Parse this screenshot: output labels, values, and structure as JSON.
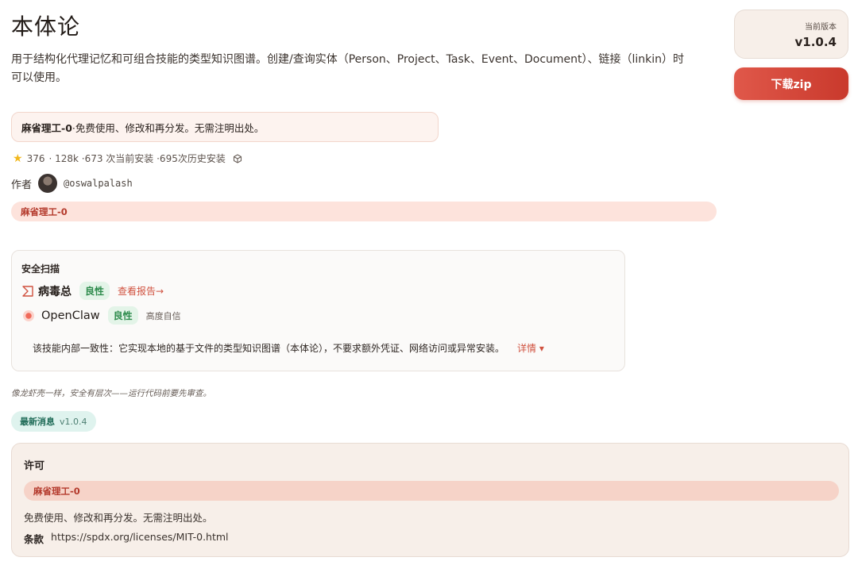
{
  "header": {
    "title": "本体论",
    "description": "用于结构化代理记忆和可组合技能的类型知识图谱。创建/查询实体（Person、Project、Task、Event、Document）、链接（linkin）时可以使用。"
  },
  "version_card": {
    "label": "当前版本",
    "value": "v1.0.4"
  },
  "download": {
    "label": "下载zip"
  },
  "license_notice": {
    "name": "麻省理工-0",
    "text": "·免费使用、修改和再分发。无需注明出处。"
  },
  "stats": {
    "stars": "376",
    "text": "· 128k ·673 次当前安装 ·695次历史安装"
  },
  "author": {
    "label": "作者",
    "handle": "@oswalpalash"
  },
  "license_tag": "麻省理工-0",
  "security_scan": {
    "title": "安全扫描",
    "scanners": [
      {
        "name": "病毒总",
        "verdict": "良性",
        "link": "查看报告→"
      },
      {
        "name": "OpenClaw",
        "verdict": "良性",
        "confidence": "高度自信"
      }
    ],
    "summary": "该技能内部一致性：它实现本地的基于文件的类型知识图谱（本体论），不要求额外凭证、网络访问或异常安装。",
    "details_label": "详情 ▾"
  },
  "footnote": "像龙虾壳一样，安全有层次——运行代码前要先审查。",
  "news": {
    "label": "最新消息",
    "version": "v1.0.4"
  },
  "license_card": {
    "title": "许可",
    "name": "麻省理工-0",
    "text": "免费使用、修改和再分发。无需注明出处。",
    "terms_label": "条款",
    "terms_url": "https://spdx.org/licenses/MIT-0.html"
  },
  "colors": {
    "accent": "#d0513f",
    "download_button": "#d9473a",
    "benign_badge": "#2d8b4c",
    "star": "#f2b81d"
  },
  "icons": [
    "star-icon",
    "cube-icon",
    "virustotal-icon",
    "openclaw-icon",
    "chevron-down-icon"
  ]
}
